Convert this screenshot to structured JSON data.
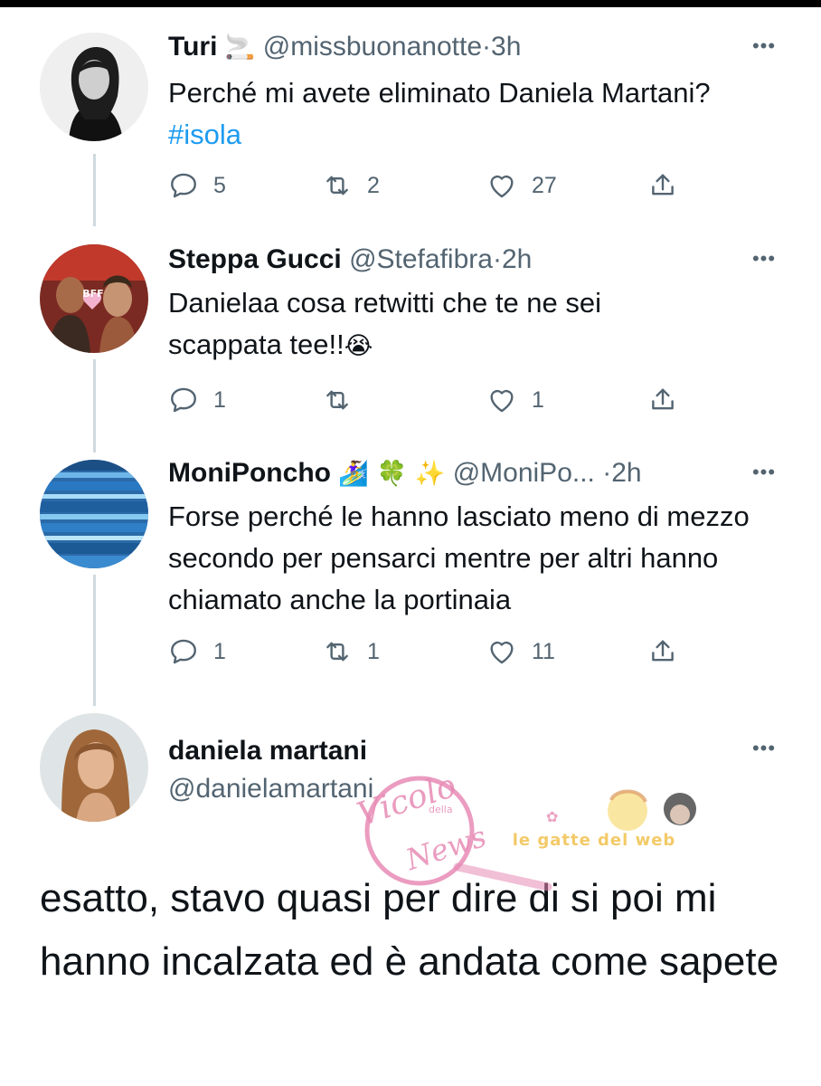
{
  "thread": [
    {
      "name": "Turi",
      "name_emoji": "🚬",
      "handle": "@missbuonanotte",
      "separator": "·",
      "time": "3h",
      "text": "Perché mi avete eliminato Daniela Martani?",
      "hashtag": "#isola",
      "replies": "5",
      "retweets": "2",
      "likes": "27"
    },
    {
      "name": "Steppa Gucci",
      "handle": "@Stefafibra",
      "separator": "·",
      "time": "2h",
      "text_line1": "Danielaa cosa retwitti che te ne sei",
      "text_line2": "scappata tee!!",
      "text_emoji": "😭",
      "avatar_badge": "BFF",
      "replies": "1",
      "retweets": "",
      "likes": "1"
    },
    {
      "name": "MoniPoncho",
      "name_emoji": "🏄‍♀️ 🍀 ✨",
      "handle": "@MoniPo...",
      "separator": "·",
      "time": "2h",
      "text": "Forse perché le hanno lasciato meno di mezzo secondo per pensarci mentre per altri  hanno chiamato anche la portinaia",
      "replies": "1",
      "retweets": "1",
      "likes": "11"
    }
  ],
  "main_tweet": {
    "name": "daniela martani",
    "handle": "@danielamartani",
    "text": "esatto, stavo quasi per dire di si poi mi hanno incalzata ed è andata come sapete"
  },
  "more_icon": "•••",
  "icons": {
    "reply": "reply-icon",
    "retweet": "retweet-icon",
    "like": "heart-icon",
    "share": "share-icon",
    "more": "more-options-icon"
  },
  "watermarks": {
    "vicolo_line1": "Vicolo",
    "vicolo_line2": "della",
    "vicolo_line3": "News",
    "gatte": "le gatte del web"
  },
  "colors": {
    "text": "#0f1419",
    "secondary": "#536471",
    "link": "#1d9bf0",
    "thread_line": "#cfd9de",
    "watermark_pink": "#e78bb5"
  }
}
